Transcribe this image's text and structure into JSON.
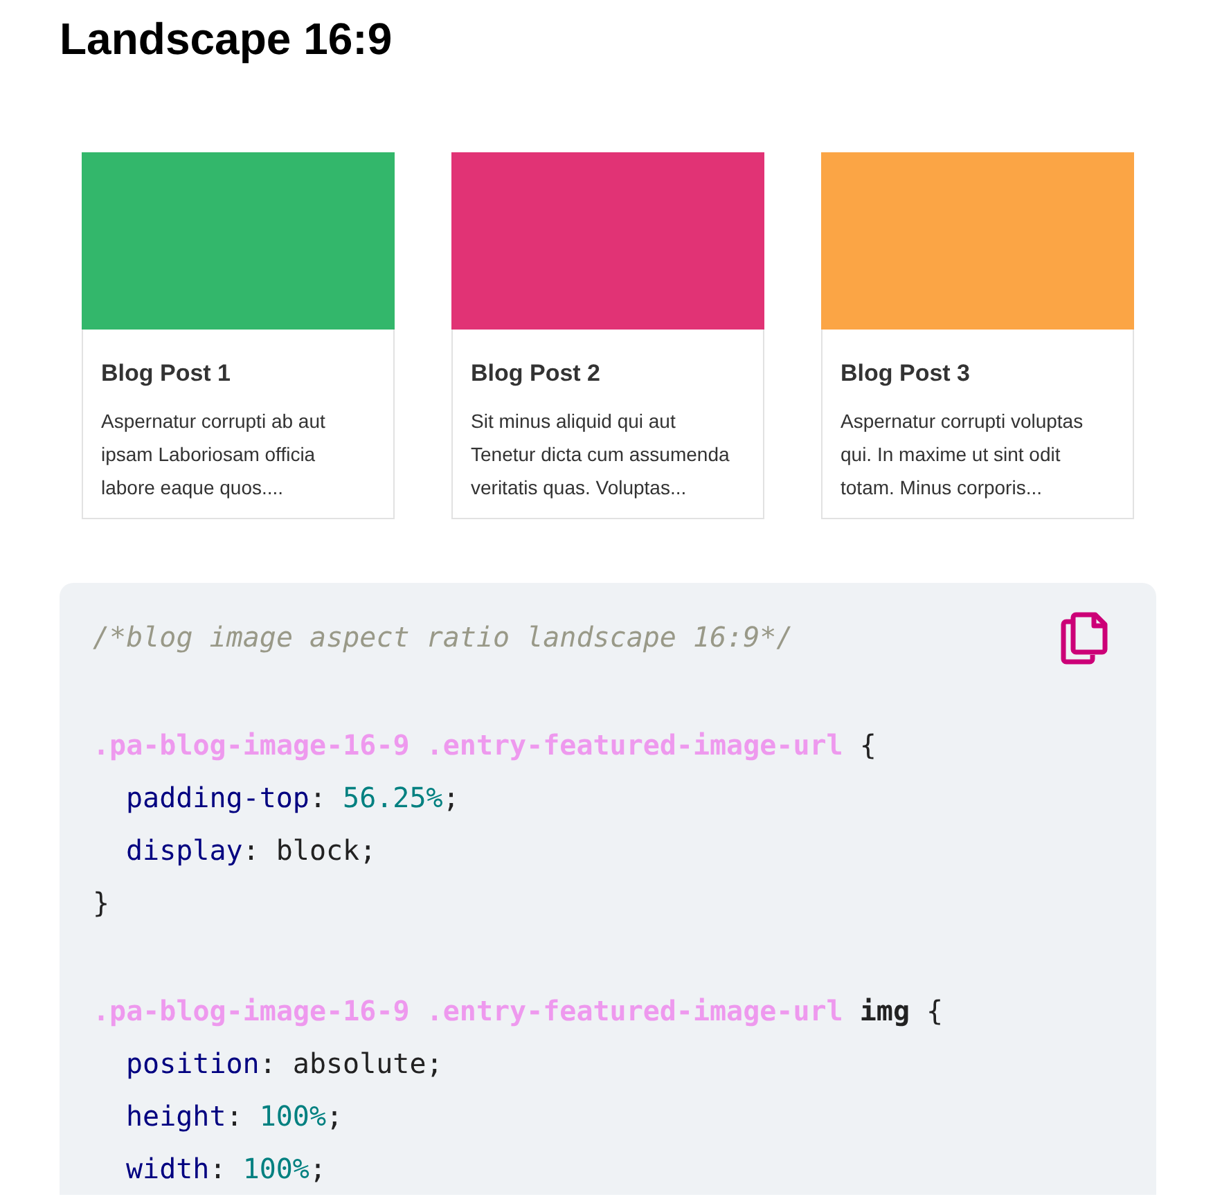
{
  "heading": "Landscape 16:9",
  "cards": [
    {
      "color": "#33b76b",
      "title": "Blog Post 1",
      "excerpt": "Aspernatur corrupti ab aut ipsam Laboriosam officia labore eaque quos...."
    },
    {
      "color": "#e13375",
      "title": "Blog Post 2",
      "excerpt": "Sit minus aliquid qui aut Tenetur dicta cum assumenda veritatis quas. Voluptas..."
    },
    {
      "color": "#fba545",
      "title": "Blog Post 3",
      "excerpt": "Aspernatur corrupti voluptas qui. In maxime ut sint odit totam. Minus corporis..."
    }
  ],
  "code": {
    "blocks": [
      [
        {
          "indented": false,
          "tokens": [
            {
              "kind": "comment",
              "text": "/*blog image aspect ratio landscape 16:9*/"
            }
          ]
        }
      ],
      [
        {
          "indented": false,
          "tokens": [
            {
              "kind": "selector",
              "text": ".pa-blog-image-16-9 .entry-featured-image-url"
            },
            {
              "kind": "plain",
              "text": " {"
            }
          ]
        },
        {
          "indented": true,
          "tokens": [
            {
              "kind": "property",
              "text": "padding-top"
            },
            {
              "kind": "plain",
              "text": ": "
            },
            {
              "kind": "number",
              "text": "56.25%"
            },
            {
              "kind": "plain",
              "text": ";"
            }
          ]
        },
        {
          "indented": true,
          "tokens": [
            {
              "kind": "property",
              "text": "display"
            },
            {
              "kind": "plain",
              "text": ": block;"
            }
          ]
        },
        {
          "indented": false,
          "tokens": [
            {
              "kind": "plain",
              "text": "}"
            }
          ]
        }
      ],
      [
        {
          "indented": false,
          "tokens": [
            {
              "kind": "selector",
              "text": ".pa-blog-image-16-9 .entry-featured-image-url"
            },
            {
              "kind": "tag",
              "text": "img"
            },
            {
              "kind": "plain",
              "text": " {"
            }
          ]
        },
        {
          "indented": true,
          "tokens": [
            {
              "kind": "property",
              "text": "position"
            },
            {
              "kind": "plain",
              "text": ": absolute;"
            }
          ]
        },
        {
          "indented": true,
          "tokens": [
            {
              "kind": "property",
              "text": "height"
            },
            {
              "kind": "plain",
              "text": ": "
            },
            {
              "kind": "number",
              "text": "100%"
            },
            {
              "kind": "plain",
              "text": ";"
            }
          ]
        },
        {
          "indented": true,
          "tokens": [
            {
              "kind": "property",
              "text": "width"
            },
            {
              "kind": "plain",
              "text": ": "
            },
            {
              "kind": "number",
              "text": "100%"
            },
            {
              "kind": "plain",
              "text": ";"
            }
          ]
        }
      ]
    ]
  }
}
